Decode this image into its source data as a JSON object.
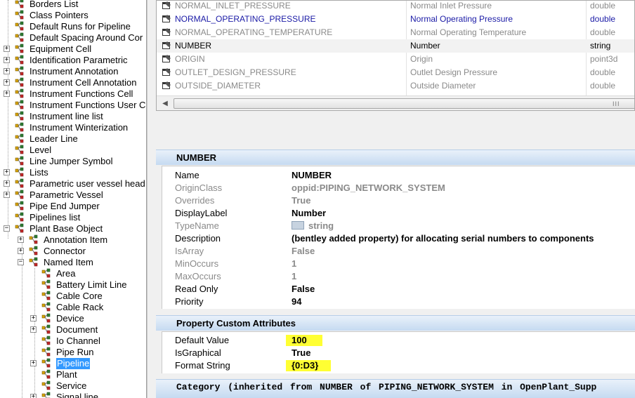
{
  "tree": {
    "items": [
      {
        "label": "Borders List"
      },
      {
        "label": "Class Pointers"
      },
      {
        "label": "Default Runs for Pipeline"
      },
      {
        "label": "Default Spacing Around Cor"
      },
      {
        "label": "Equipment Cell"
      },
      {
        "label": "Identification Parametric"
      },
      {
        "label": "Instrument Annotation"
      },
      {
        "label": "Instrument Cell Annotation"
      },
      {
        "label": "Instrument Functions Cell"
      },
      {
        "label": "Instrument Functions User C"
      },
      {
        "label": "Instrument line list"
      },
      {
        "label": "Instrument Winterization"
      },
      {
        "label": "Leader Line"
      },
      {
        "label": "Level"
      },
      {
        "label": "Line Jumper Symbol"
      },
      {
        "label": "Lists"
      },
      {
        "label": "Parametric user vessel head"
      },
      {
        "label": "Parametric Vessel"
      },
      {
        "label": "Pipe End Jumper"
      },
      {
        "label": "Pipelines list"
      },
      {
        "label": "Plant Base Object"
      },
      {
        "label": "Annotation Item"
      },
      {
        "label": "Connector"
      },
      {
        "label": "Named Item"
      },
      {
        "label": "Area"
      },
      {
        "label": "Battery Limit Line"
      },
      {
        "label": "Cable Core"
      },
      {
        "label": "Cable Rack"
      },
      {
        "label": "Device"
      },
      {
        "label": "Document"
      },
      {
        "label": "Io Channel"
      },
      {
        "label": "Pipe Run"
      },
      {
        "label": "Pipeline"
      },
      {
        "label": "Plant"
      },
      {
        "label": "Service"
      },
      {
        "label": "Signal line"
      }
    ]
  },
  "property_list": {
    "rows": [
      {
        "name": "NORMAL_INLET_PRESSURE",
        "display": "Normal Inlet Pressure",
        "type": "double"
      },
      {
        "name": "NORMAL_OPERATING_PRESSURE",
        "display": "Normal Operating Pressure",
        "type": "double"
      },
      {
        "name": "NORMAL_OPERATING_TEMPERATURE",
        "display": "Normal Operating Temperature",
        "type": "double"
      },
      {
        "name": "NUMBER",
        "display": "Number",
        "type": "string"
      },
      {
        "name": "ORIGIN",
        "display": "Origin",
        "type": "point3d"
      },
      {
        "name": "OUTLET_DESIGN_PRESSURE",
        "display": "Outlet Design Pressure",
        "type": "double"
      },
      {
        "name": "OUTSIDE_DIAMETER",
        "display": "Outside Diameter",
        "type": "double"
      }
    ],
    "scroll_grip": "III"
  },
  "details": {
    "title": "NUMBER",
    "rows": [
      {
        "key": "Name",
        "value": "NUMBER"
      },
      {
        "key": "OriginClass",
        "value": "oppid:PIPING_NETWORK_SYSTEM"
      },
      {
        "key": "Overrides",
        "value": "True"
      },
      {
        "key": "DisplayLabel",
        "value": "Number"
      },
      {
        "key": "TypeName",
        "value": "string"
      },
      {
        "key": "Description",
        "value": "(bentley added property) for allocating serial numbers to components"
      },
      {
        "key": "IsArray",
        "value": "False"
      },
      {
        "key": "MinOccurs",
        "value": "1"
      },
      {
        "key": "MaxOccurs",
        "value": "1"
      },
      {
        "key": "Read Only",
        "value": "False"
      },
      {
        "key": "Priority",
        "value": "94"
      }
    ]
  },
  "custom_attributes": {
    "title": "Property Custom Attributes",
    "rows": [
      {
        "key": "Default Value",
        "value": "100"
      },
      {
        "key": "IsGraphical",
        "value": "True"
      },
      {
        "key": "Format String",
        "value": "{0:D3}"
      }
    ]
  },
  "category": {
    "title": "Category (inherited from NUMBER of PIPING_NETWORK_SYSTEM in OpenPlant_Supp"
  },
  "colors": {
    "selection": "#3399ff",
    "highlight": "#ffff33",
    "header_gradient_top": "#e9f1fa",
    "header_gradient_bottom": "#c5daf1",
    "link_blue": "#1a1aa6"
  },
  "icons": {
    "tree_class": "ec-class-icon",
    "property": "property-icon",
    "type": "type-icon"
  }
}
